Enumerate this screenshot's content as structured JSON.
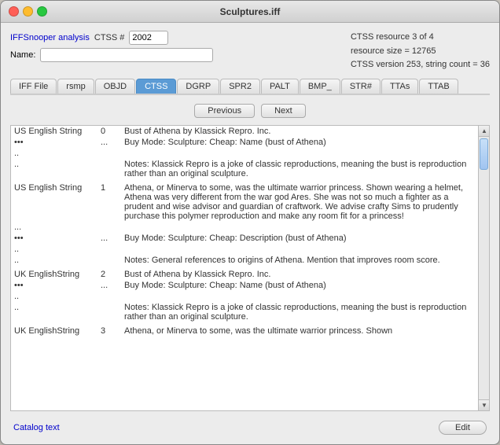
{
  "window": {
    "title": "Sculptures.iff"
  },
  "header": {
    "analysis_label": "IFFSnooper analysis",
    "ctss_label": "CTSS #",
    "ctss_number": "2002",
    "ctss_resource_info": "CTSS resource 3 of 4",
    "resource_size_label": "resource size =  12765",
    "ctss_version_label": "CTSS version 253, string count = 36",
    "name_label": "Name:"
  },
  "tabs": [
    {
      "label": "IFF File",
      "active": false
    },
    {
      "label": "rsmp",
      "active": false
    },
    {
      "label": "OBJD",
      "active": false
    },
    {
      "label": "CTSS",
      "active": true
    },
    {
      "label": "DGRP",
      "active": false
    },
    {
      "label": "SPR2",
      "active": false
    },
    {
      "label": "PALT",
      "active": false
    },
    {
      "label": "BMP_",
      "active": false
    },
    {
      "label": "STR#",
      "active": false
    },
    {
      "label": "TTAs",
      "active": false
    },
    {
      "label": "TTAB",
      "active": false
    }
  ],
  "nav": {
    "previous_label": "Previous",
    "next_label": "Next"
  },
  "table": {
    "rows": [
      {
        "col1": "US English String",
        "col2": "0",
        "col3": "Bust of Athena by Klassick Repro. Inc."
      },
      {
        "col1": "•••",
        "col2": "...",
        "col3": "Buy Mode: Sculpture:  Cheap:  Name (bust of Athena)"
      },
      {
        "col1": "..",
        "col2": "",
        "col3": ""
      },
      {
        "col1": "..",
        "col2": "",
        "col3": "Notes: Klassick Repro is a joke of classic reproductions, meaning the bust is reproduction rather than an original sculpture."
      },
      {
        "col1": "",
        "col2": "",
        "col3": ""
      },
      {
        "col1": "US English String",
        "col2": "1",
        "col3": "Athena, or Minerva to some, was the ultimate warrior princess. Shown wearing a helmet, Athena was very different from the war god Ares. She was not so much a fighter as a prudent and wise advisor and guardian of craftwork. We advise crafty Sims to prudently purchase this polymer reproduction and make any room fit for a princess!"
      },
      {
        "col1": "...",
        "col2": "",
        "col3": ""
      },
      {
        "col1": "•••",
        "col2": "...",
        "col3": "Buy Mode: Sculpture:  Cheap: Description (bust of Athena)"
      },
      {
        "col1": "..",
        "col2": "",
        "col3": ""
      },
      {
        "col1": "..",
        "col2": "",
        "col3": "Notes: General references to origins of Athena. Mention that improves room score."
      },
      {
        "col1": "",
        "col2": "",
        "col3": ""
      },
      {
        "col1": "UK EnglishString",
        "col2": "2",
        "col3": "Bust of Athena by Klassick Repro. Inc."
      },
      {
        "col1": "•••",
        "col2": "...",
        "col3": "Buy Mode: Sculpture:  Cheap:  Name (bust of Athena)"
      },
      {
        "col1": "..",
        "col2": "",
        "col3": ""
      },
      {
        "col1": "..",
        "col2": "",
        "col3": "Notes: Klassick Repro is a joke of classic reproductions, meaning the bust is reproduction rather than an original sculpture."
      },
      {
        "col1": "",
        "col2": "",
        "col3": ""
      },
      {
        "col1": "UK EnglishString",
        "col2": "3",
        "col3": "Athena, or Minerva to some, was the ultimate warrior princess. Shown"
      }
    ]
  },
  "bottom": {
    "catalog_text_label": "Catalog text",
    "edit_label": "Edit"
  }
}
